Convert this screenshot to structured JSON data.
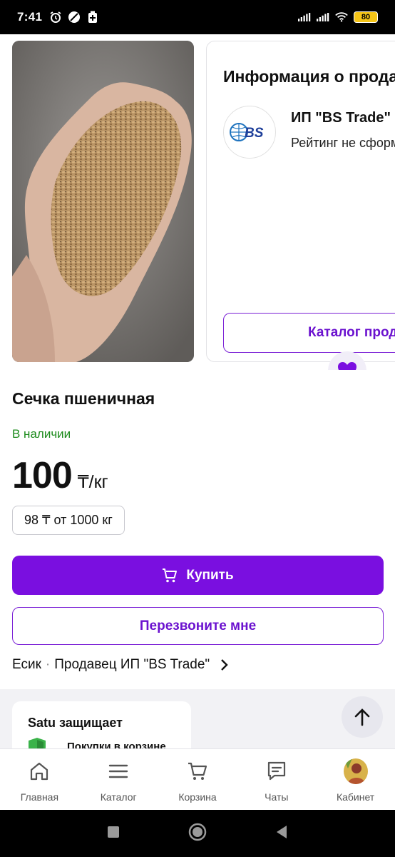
{
  "status_bar": {
    "time": "7:41",
    "battery": "80"
  },
  "seller_card": {
    "title": "Информация о продавце",
    "seller_name": "ИП \"BS Trade\"",
    "rating_text": "Рейтинг не сформирован",
    "catalog_button": "Каталог продавца",
    "logo_text": "BS"
  },
  "product": {
    "title": "Сечка пшеничная",
    "availability": "В наличии",
    "price": "100",
    "price_unit": "₸/кг",
    "wholesale": "98 ₸ от 1000 кг"
  },
  "actions": {
    "buy_label": "Купить",
    "callback_label": "Перезвоните мне"
  },
  "seller_line": {
    "city": "Есик",
    "separator": "·",
    "seller_text": "Продавец ИП \"BS Trade\""
  },
  "protection": {
    "title": "Satu защищает",
    "item": "Покупки в корзине"
  },
  "bottom_nav": {
    "items": [
      {
        "label": "Главная",
        "icon": "home-icon"
      },
      {
        "label": "Каталог",
        "icon": "menu-icon"
      },
      {
        "label": "Корзина",
        "icon": "cart-icon"
      },
      {
        "label": "Чаты",
        "icon": "chat-icon"
      },
      {
        "label": "Кабинет",
        "icon": "avatar"
      }
    ]
  },
  "colors": {
    "accent": "#7a0fe0",
    "in_stock": "#1a8a1a"
  }
}
